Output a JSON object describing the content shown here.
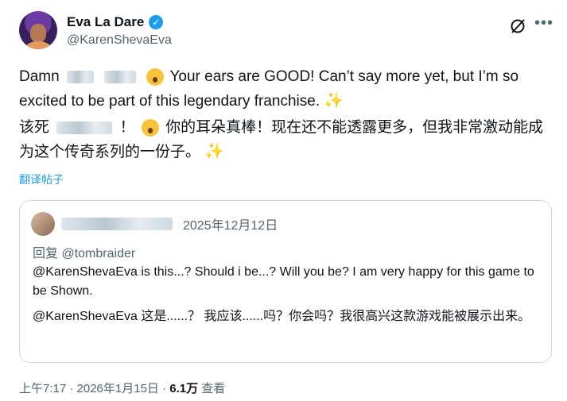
{
  "author": {
    "name": "Eva La Dare",
    "handle": "@KarenShevaEva"
  },
  "tweet": {
    "en_prefix": "Damn",
    "en_text": "Your ears are GOOD! Can’t say more yet, but I’m so excited to be part of this legendary franchise.",
    "zh_prefix": "该死",
    "zh_bang": "！",
    "zh_text": "你的耳朵真棒！现在还不能透露更多，但我非常激动能成为这个传奇系列的一份子。",
    "sparkle": "✨",
    "translate_label": "翻译帖子"
  },
  "quote": {
    "date": "2025年12月12日",
    "reply_label": "回复",
    "reply_to": "@tombraider",
    "en_text": "@KarenShevaEva is this...? Should i be...? Will you be? I am very happy for this game to be Shown.",
    "zh_text": "@KarenShevaEva 这是......？ 我应该......吗？你会吗？我很高兴这款游戏能被展示出来。"
  },
  "meta": {
    "time": "上午7:17 · 2026年1月15日 · ",
    "views": "6.1万",
    "views_label": " 查看"
  },
  "icons": {
    "verified": "verified-badge-icon",
    "grok": "grok-icon",
    "more": "more-icon",
    "verified_color": "#1d9bf0",
    "link_color": "#1d9bf0"
  }
}
